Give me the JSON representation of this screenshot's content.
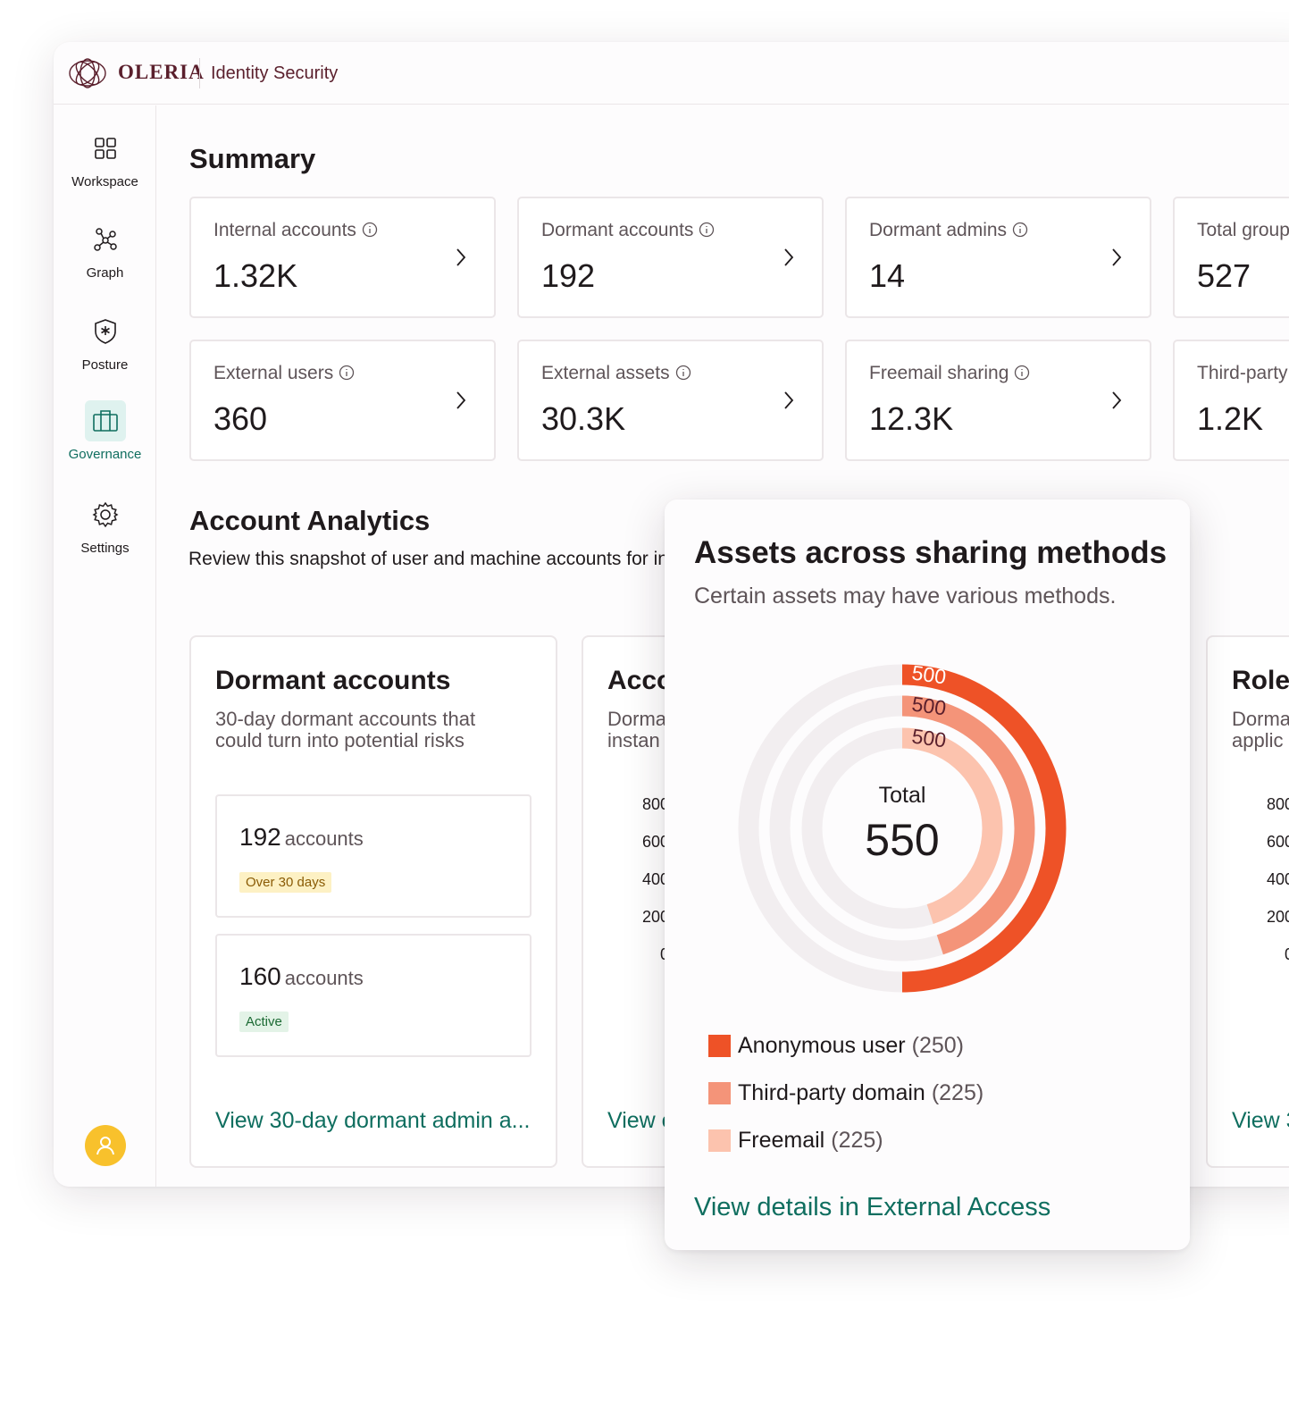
{
  "app": {
    "brand": "OLERIA",
    "product": "Identity Security"
  },
  "sidebar": {
    "items": [
      {
        "label": "Workspace",
        "icon": "grid-icon"
      },
      {
        "label": "Graph",
        "icon": "graph-icon"
      },
      {
        "label": "Posture",
        "icon": "shield-star-icon"
      },
      {
        "label": "Governance",
        "icon": "briefcase-icon",
        "active": true
      },
      {
        "label": "Settings",
        "icon": "gear-icon"
      }
    ],
    "avatar": "user-icon"
  },
  "summary": {
    "title": "Summary",
    "cards": [
      {
        "label": "Internal accounts",
        "value": "1.32K"
      },
      {
        "label": "Dormant accounts",
        "value": "192"
      },
      {
        "label": "Dormant admins",
        "value": "14"
      },
      {
        "label": "Total groups",
        "value": "527"
      },
      {
        "label": "External users",
        "value": "360"
      },
      {
        "label": "External assets",
        "value": "30.3K"
      },
      {
        "label": "Freemail sharing",
        "value": "12.3K"
      },
      {
        "label": "Third-party",
        "value": "1.2K"
      }
    ]
  },
  "analytics": {
    "title": "Account Analytics",
    "subtitle": "Review this snapshot of user and machine accounts for insights to enhance security",
    "panels": [
      {
        "title": "Dormant accounts",
        "description": "30-day dormant accounts that could turn into potential risks",
        "items": [
          {
            "count": "192",
            "unit": "accounts",
            "tag": "Over 30 days"
          },
          {
            "count": "160",
            "unit": "accounts",
            "tag": "Active"
          }
        ],
        "link": "View 30-day dormant admin a..."
      },
      {
        "title": "Acco",
        "description": "Dorma instan",
        "axis": [
          "800",
          "600",
          "400",
          "200",
          "0"
        ],
        "link": "View c"
      },
      {
        "title": "Roles",
        "description": "Dorma applic",
        "axis": [
          "800",
          "600",
          "400",
          "200",
          "0"
        ],
        "link": "View 3"
      }
    ]
  },
  "popover": {
    "title": "Assets across sharing methods",
    "subtitle": "Certain assets may have various methods.",
    "center_label": "Total",
    "center_value": "550",
    "ring_max_labels": [
      "500",
      "500",
      "500"
    ],
    "link": "View details in External Access",
    "colors": {
      "anonymous": "#ee5227",
      "third_party": "#f49479",
      "freemail": "#fcc3ae",
      "track": "#f2eef0",
      "link": "#0f6e5f"
    }
  },
  "chart_data": {
    "type": "pie",
    "title": "Assets across sharing methods",
    "series": [
      {
        "name": "Anonymous user",
        "value": 250,
        "max": 500
      },
      {
        "name": "Third-party domain",
        "value": 225,
        "max": 500
      },
      {
        "name": "Freemail",
        "value": 225,
        "max": 500
      }
    ],
    "total": 550,
    "legend": "bottom"
  }
}
